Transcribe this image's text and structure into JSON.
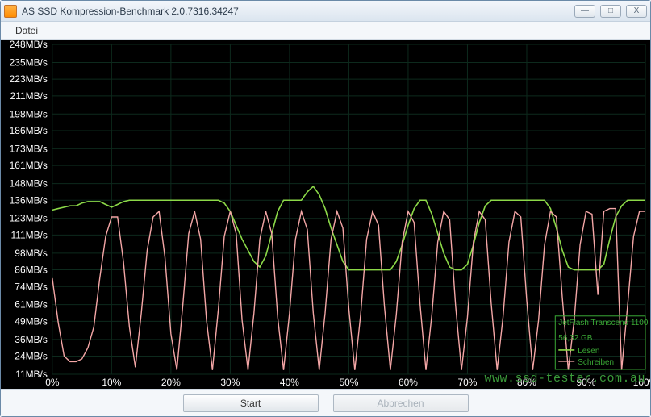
{
  "window": {
    "title": "AS SSD Kompression-Benchmark 2.0.7316.34247",
    "btn_min": "—",
    "btn_max": "□",
    "btn_close": "X"
  },
  "menu": {
    "file": "Datei"
  },
  "footer": {
    "start": "Start",
    "cancel": "Abbrechen"
  },
  "watermark": "www.ssd-tester.com.au",
  "legend": {
    "device": "JetFlash Transcend 1100",
    "size": "56,32 GB",
    "read": "Lesen",
    "write": "Schreiben"
  },
  "chart_data": {
    "type": "line",
    "title": "",
    "xlabel": "",
    "ylabel": "",
    "ylim": [
      11,
      248
    ],
    "xlim": [
      0,
      100
    ],
    "y_ticks": [
      248,
      235,
      223,
      211,
      198,
      186,
      173,
      161,
      148,
      136,
      123,
      111,
      98,
      86,
      74,
      61,
      49,
      36,
      24,
      11
    ],
    "y_tick_suffix": "MB/s",
    "x_ticks": [
      0,
      10,
      20,
      30,
      40,
      50,
      60,
      70,
      80,
      90,
      100
    ],
    "x_tick_suffix": "%",
    "x": [
      0,
      1,
      2,
      3,
      4,
      5,
      6,
      7,
      8,
      9,
      10,
      11,
      12,
      13,
      14,
      15,
      16,
      17,
      18,
      19,
      20,
      21,
      22,
      23,
      24,
      25,
      26,
      27,
      28,
      29,
      30,
      31,
      32,
      33,
      34,
      35,
      36,
      37,
      38,
      39,
      40,
      41,
      42,
      43,
      44,
      45,
      46,
      47,
      48,
      49,
      50,
      51,
      52,
      53,
      54,
      55,
      56,
      57,
      58,
      59,
      60,
      61,
      62,
      63,
      64,
      65,
      66,
      67,
      68,
      69,
      70,
      71,
      72,
      73,
      74,
      75,
      76,
      77,
      78,
      79,
      80,
      81,
      82,
      83,
      84,
      85,
      86,
      87,
      88,
      89,
      90,
      91,
      92,
      93,
      94,
      95,
      96,
      97,
      98,
      99,
      100
    ],
    "series": [
      {
        "name": "Lesen",
        "color": "#8cd948",
        "values": [
          129,
          130,
          131,
          132,
          132,
          134,
          135,
          135,
          135,
          133,
          131,
          133,
          135,
          136,
          136,
          136,
          136,
          136,
          136,
          136,
          136,
          136,
          136,
          136,
          136,
          136,
          136,
          136,
          136,
          134,
          128,
          118,
          108,
          100,
          92,
          88,
          96,
          112,
          128,
          136,
          136,
          136,
          136,
          142,
          146,
          140,
          130,
          116,
          104,
          92,
          86,
          86,
          86,
          86,
          86,
          86,
          86,
          86,
          92,
          104,
          118,
          130,
          136,
          136,
          126,
          112,
          98,
          88,
          86,
          86,
          90,
          104,
          120,
          132,
          136,
          136,
          136,
          136,
          136,
          136,
          136,
          136,
          136,
          136,
          130,
          116,
          100,
          88,
          86,
          86,
          86,
          86,
          86,
          90,
          108,
          124,
          132,
          136,
          136,
          136,
          136
        ]
      },
      {
        "name": "Schreiben",
        "color": "#f4a6a6",
        "values": [
          80,
          48,
          24,
          20,
          20,
          22,
          30,
          45,
          80,
          110,
          124,
          124,
          92,
          45,
          16,
          55,
          100,
          124,
          128,
          95,
          40,
          14,
          60,
          112,
          128,
          108,
          50,
          14,
          58,
          110,
          128,
          112,
          50,
          14,
          55,
          108,
          128,
          112,
          52,
          14,
          55,
          108,
          128,
          115,
          55,
          14,
          55,
          108,
          128,
          116,
          58,
          14,
          54,
          108,
          128,
          118,
          60,
          14,
          54,
          106,
          128,
          120,
          62,
          14,
          54,
          106,
          128,
          122,
          60,
          14,
          52,
          106,
          128,
          122,
          62,
          14,
          52,
          106,
          128,
          124,
          64,
          14,
          50,
          104,
          128,
          124,
          66,
          14,
          50,
          104,
          128,
          126,
          68,
          128,
          130,
          130,
          14,
          60,
          110,
          128,
          128
        ]
      }
    ]
  }
}
